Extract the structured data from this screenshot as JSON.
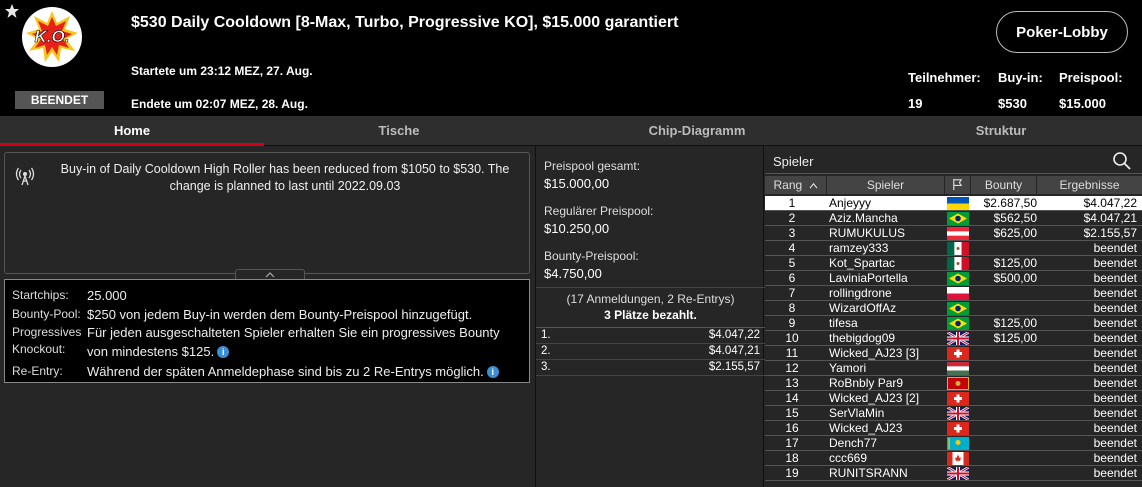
{
  "header": {
    "title": "$530 Daily Cooldown [8-Max, Turbo, Progressive KO], $15.000 garantiert",
    "logo_text": "K.O.",
    "status_badge": "BEENDET",
    "started": "Startete um 23:12 MEZ, 27. Aug.",
    "ended": "Endete um 02:07 MEZ, 28. Aug.",
    "lobby_button": "Poker-Lobby",
    "stats": [
      {
        "label": "Teilnehmer:",
        "value": "19"
      },
      {
        "label": "Buy-in:",
        "value": "$530"
      },
      {
        "label": "Preispool:",
        "value": "$15.000"
      }
    ]
  },
  "tabs": [
    "Home",
    "Tische",
    "Chip-Diagramm",
    "Struktur"
  ],
  "notice": {
    "text": "Buy-in of Daily Cooldown High Roller has been reduced from $1050 to $530. The change is planned to last until 2022.09.03"
  },
  "info": {
    "startchips_label": "Startchips:",
    "startchips_value": "25.000",
    "bounty_label": "Bounty-Pool:",
    "bounty_value": "$250 von jedem Buy-in werden dem Bounty-Preispool hinzugefügt.",
    "pko_label_1": "Progressives",
    "pko_label_2": "Knockout:",
    "pko_value_1": "Für jeden ausgeschalteten Spieler erhalten Sie ein progressives Bounty",
    "pko_value_2": "von mindestens $125.",
    "reentry_label": "Re-Entry:",
    "reentry_value": "Während der späten Anmeldephase sind bis zu 2 Re-Entrys möglich."
  },
  "prizes": {
    "total_label": "Preispool gesamt:",
    "total_value": "$15.000,00",
    "regular_label": "Regulärer Preispool:",
    "regular_value": "$10.250,00",
    "bounty_label": "Bounty-Preispool:",
    "bounty_value": "$4.750,00",
    "entries": "(17 Anmeldungen, 2 Re-Entrys)",
    "paid": "3 Plätze bezahlt.",
    "payouts": [
      {
        "rank": "1.",
        "amount": "$4.047,22"
      },
      {
        "rank": "2.",
        "amount": "$4.047,21"
      },
      {
        "rank": "3.",
        "amount": "$2.155,57"
      }
    ]
  },
  "players": {
    "search_placeholder": "Spieler",
    "headers": {
      "rank": "Rang",
      "player": "Spieler",
      "bounty": "Bounty",
      "result": "Ergebnisse"
    },
    "rows": [
      {
        "rank": "1",
        "name": "Anjeyyy",
        "flag": "ua",
        "bounty": "$2.687,50",
        "result": "$4.047,22"
      },
      {
        "rank": "2",
        "name": "Aziz.Mancha",
        "flag": "br",
        "bounty": "$562,50",
        "result": "$4.047,21"
      },
      {
        "rank": "3",
        "name": "RUMUKULUS",
        "flag": "at",
        "bounty": "$625,00",
        "result": "$2.155,57"
      },
      {
        "rank": "4",
        "name": "ramzey333",
        "flag": "mx",
        "bounty": "",
        "result": "beendet"
      },
      {
        "rank": "5",
        "name": "Kot_Spartac",
        "flag": "mx",
        "bounty": "$125,00",
        "result": "beendet"
      },
      {
        "rank": "6",
        "name": "LaviniaPortella",
        "flag": "br",
        "bounty": "$500,00",
        "result": "beendet"
      },
      {
        "rank": "7",
        "name": "rollingdrone",
        "flag": "pl",
        "bounty": "",
        "result": "beendet"
      },
      {
        "rank": "8",
        "name": "WizardOffAz",
        "flag": "br",
        "bounty": "",
        "result": "beendet"
      },
      {
        "rank": "9",
        "name": "tifesa",
        "flag": "br",
        "bounty": "$125,00",
        "result": "beendet"
      },
      {
        "rank": "10",
        "name": "thebigdog09",
        "flag": "gb",
        "bounty": "$125,00",
        "result": "beendet"
      },
      {
        "rank": "11",
        "name": "Wicked_AJ23 [3]",
        "flag": "ch",
        "bounty": "",
        "result": "beendet"
      },
      {
        "rank": "12",
        "name": "Yamori",
        "flag": "hu",
        "bounty": "",
        "result": "beendet"
      },
      {
        "rank": "13",
        "name": "RoBnbly Par9",
        "flag": "me",
        "bounty": "",
        "result": "beendet"
      },
      {
        "rank": "14",
        "name": "Wicked_AJ23 [2]",
        "flag": "ch",
        "bounty": "",
        "result": "beendet"
      },
      {
        "rank": "15",
        "name": "SerVlaMin",
        "flag": "gb",
        "bounty": "",
        "result": "beendet"
      },
      {
        "rank": "16",
        "name": "Wicked_AJ23",
        "flag": "ch",
        "bounty": "",
        "result": "beendet"
      },
      {
        "rank": "17",
        "name": "Dench77",
        "flag": "kz",
        "bounty": "",
        "result": "beendet"
      },
      {
        "rank": "18",
        "name": "ccc669",
        "flag": "ca",
        "bounty": "",
        "result": "beendet"
      },
      {
        "rank": "19",
        "name": "RUNITSRANN",
        "flag": "gb",
        "bounty": "",
        "result": "beendet"
      }
    ]
  },
  "colors": {
    "accent": "#d0021b",
    "info": "#3b8fd4",
    "panel": "#262626"
  }
}
